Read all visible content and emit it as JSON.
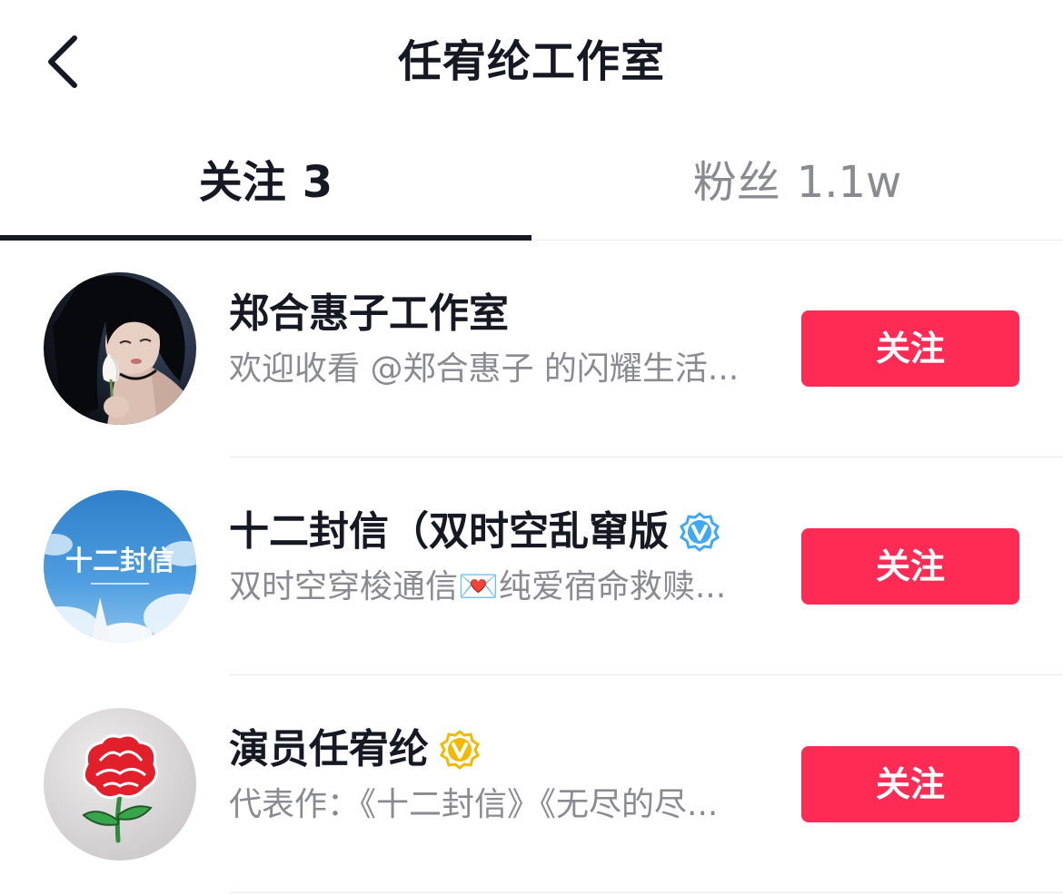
{
  "header": {
    "title": "任宥纶工作室",
    "back_icon": "chevron-left-icon"
  },
  "tabs": [
    {
      "label": "关注",
      "count": "3",
      "active": true
    },
    {
      "label": "粉丝",
      "count": "1.1w",
      "active": false
    }
  ],
  "users": [
    {
      "name": "郑合惠子工作室",
      "description": "欢迎收看 @郑合惠子 的闪耀生活...",
      "verified": false,
      "avatar_icon": "portrait-photo",
      "button_label": "关注"
    },
    {
      "name": "十二封信（双时空乱窜版",
      "description": "双时空穿梭通信💌纯爱宿命救赎...",
      "verified": true,
      "verify_color": "#3fa9f5",
      "verify_icon": "verified-blue-icon",
      "avatar_icon": "sky-poster",
      "avatar_text": "十二封信",
      "button_label": "关注"
    },
    {
      "name": "演员任宥纶",
      "description": "代表作：《十二封信》《无尽的尽...",
      "verified": true,
      "verify_color": "#f5b800",
      "verify_icon": "verified-gold-icon",
      "avatar_icon": "red-flower",
      "button_label": "关注"
    }
  ],
  "colors": {
    "accent": "#fe2c55",
    "text_primary": "#161823",
    "text_secondary": "#8a8b91"
  }
}
